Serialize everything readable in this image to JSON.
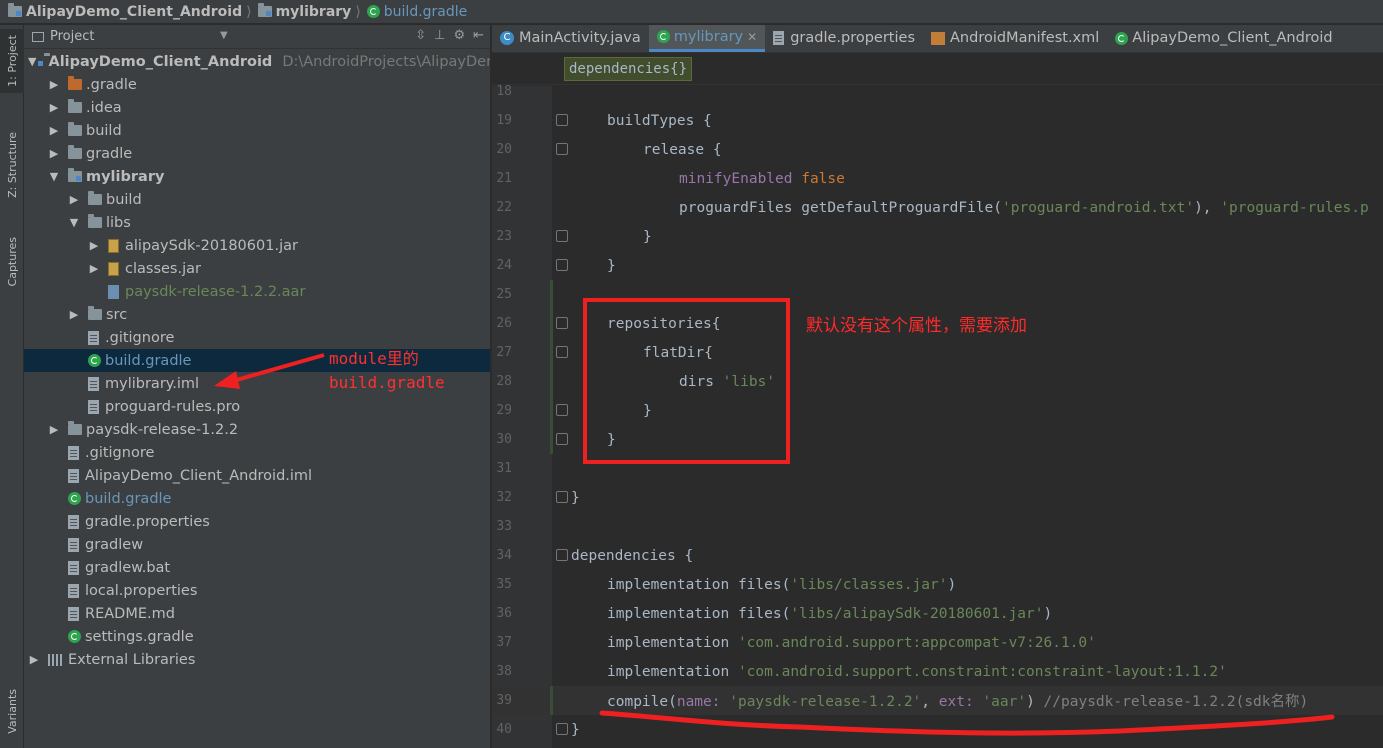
{
  "navbar": {
    "crumbs": [
      "AlipayDemo_Client_Android",
      "mylibrary",
      "build.gradle"
    ]
  },
  "tool_strip": {
    "tabs": [
      "1: Project",
      "Z: Structure",
      "Captures",
      "Variants"
    ]
  },
  "project_panel": {
    "header": "Project",
    "tree": [
      {
        "label": "AlipayDemo_Client_Android",
        "path": "D:\\AndroidProjects\\AlipayDemo_",
        "icon": "module-folder-icon",
        "arrow": "down",
        "depth": 0,
        "bold": true
      },
      {
        "label": ".gradle",
        "icon": "folder-orange-icon",
        "arrow": "right",
        "depth": 1
      },
      {
        "label": ".idea",
        "icon": "folder-icon",
        "arrow": "right",
        "depth": 1
      },
      {
        "label": "build",
        "icon": "folder-icon",
        "arrow": "right",
        "depth": 1
      },
      {
        "label": "gradle",
        "icon": "folder-icon",
        "arrow": "right",
        "depth": 1
      },
      {
        "label": "mylibrary",
        "icon": "module-folder-icon",
        "arrow": "down",
        "depth": 1,
        "bold": true
      },
      {
        "label": "build",
        "icon": "folder-icon",
        "arrow": "right",
        "depth": 2
      },
      {
        "label": "libs",
        "icon": "folder-icon",
        "arrow": "down",
        "depth": 2
      },
      {
        "label": "alipaySdk-20180601.jar",
        "icon": "jar-icon",
        "arrow": "right",
        "depth": 3
      },
      {
        "label": "classes.jar",
        "icon": "jar-icon",
        "arrow": "right",
        "depth": 3
      },
      {
        "label": "paysdk-release-1.2.2.aar",
        "icon": "aar-icon",
        "arrow": "none",
        "depth": 3,
        "color": "green"
      },
      {
        "label": "src",
        "icon": "folder-icon",
        "arrow": "right",
        "depth": 2
      },
      {
        "label": ".gitignore",
        "icon": "file-icon",
        "arrow": "none",
        "depth": 2
      },
      {
        "label": "build.gradle",
        "icon": "gradle-icon",
        "arrow": "none",
        "depth": 2,
        "selected": true,
        "color": "blue"
      },
      {
        "label": "mylibrary.iml",
        "icon": "iml-icon",
        "arrow": "none",
        "depth": 2
      },
      {
        "label": "proguard-rules.pro",
        "icon": "file-icon",
        "arrow": "none",
        "depth": 2
      },
      {
        "label": "paysdk-release-1.2.2",
        "icon": "folder-icon",
        "arrow": "right",
        "depth": 1
      },
      {
        "label": ".gitignore",
        "icon": "file-icon",
        "arrow": "none",
        "depth": 1
      },
      {
        "label": "AlipayDemo_Client_Android.iml",
        "icon": "iml-icon",
        "arrow": "none",
        "depth": 1
      },
      {
        "label": "build.gradle",
        "icon": "gradle-icon",
        "arrow": "none",
        "depth": 1,
        "color": "blue"
      },
      {
        "label": "gradle.properties",
        "icon": "properties-icon",
        "arrow": "none",
        "depth": 1
      },
      {
        "label": "gradlew",
        "icon": "file-icon",
        "arrow": "none",
        "depth": 1
      },
      {
        "label": "gradlew.bat",
        "icon": "file-icon",
        "arrow": "none",
        "depth": 1
      },
      {
        "label": "local.properties",
        "icon": "properties-icon",
        "arrow": "none",
        "depth": 1
      },
      {
        "label": "README.md",
        "icon": "file-icon",
        "arrow": "none",
        "depth": 1
      },
      {
        "label": "settings.gradle",
        "icon": "gradle-icon",
        "arrow": "none",
        "depth": 1
      },
      {
        "label": "External Libraries",
        "icon": "library-icon",
        "arrow": "right",
        "depth": 0
      }
    ]
  },
  "editor": {
    "tabs": [
      {
        "label": "MainActivity.java",
        "icon": "java-class-icon"
      },
      {
        "label": "mylibrary",
        "icon": "gradle-icon",
        "active": true,
        "closable": true
      },
      {
        "label": "gradle.properties",
        "icon": "properties-icon"
      },
      {
        "label": "AndroidManifest.xml",
        "icon": "xml-icon"
      },
      {
        "label": "AlipayDemo_Client_Android",
        "icon": "gradle-icon"
      }
    ],
    "breadcrumb_chip": "dependencies{}",
    "lines": [
      {
        "n": "18",
        "indent": 0,
        "tokens": []
      },
      {
        "n": "19",
        "indent": 1,
        "fold": true,
        "tokens": [
          [
            "plain",
            "buildTypes {"
          ]
        ]
      },
      {
        "n": "20",
        "indent": 2,
        "fold": true,
        "tokens": [
          [
            "plain",
            "release {"
          ]
        ]
      },
      {
        "n": "21",
        "indent": 3,
        "tokens": [
          [
            "prop",
            "minifyEnabled "
          ],
          [
            "kw",
            "false"
          ]
        ]
      },
      {
        "n": "22",
        "indent": 3,
        "tokens": [
          [
            "plain",
            "proguardFiles getDefaultProguardFile("
          ],
          [
            "str",
            "'proguard-android.txt'"
          ],
          [
            "plain",
            "), "
          ],
          [
            "str",
            "'proguard-rules.p"
          ]
        ]
      },
      {
        "n": "23",
        "indent": 2,
        "fold": true,
        "tokens": [
          [
            "plain",
            "}"
          ]
        ]
      },
      {
        "n": "24",
        "indent": 1,
        "fold": true,
        "tokens": [
          [
            "plain",
            "}"
          ]
        ]
      },
      {
        "n": "25",
        "indent": 0,
        "tokens": [],
        "changed": true
      },
      {
        "n": "26",
        "indent": 1,
        "fold": true,
        "tokens": [
          [
            "plain",
            "repositories{"
          ]
        ],
        "changed": true
      },
      {
        "n": "27",
        "indent": 2,
        "fold": true,
        "tokens": [
          [
            "plain",
            "flatDir{"
          ]
        ],
        "changed": true
      },
      {
        "n": "28",
        "indent": 3,
        "tokens": [
          [
            "plain",
            "dirs "
          ],
          [
            "str",
            "'libs'"
          ]
        ],
        "changed": true
      },
      {
        "n": "29",
        "indent": 2,
        "fold": true,
        "tokens": [
          [
            "plain",
            "}"
          ]
        ],
        "changed": true
      },
      {
        "n": "30",
        "indent": 1,
        "fold": true,
        "tokens": [
          [
            "plain",
            "}"
          ]
        ],
        "changed": true
      },
      {
        "n": "31",
        "indent": 0,
        "tokens": []
      },
      {
        "n": "32",
        "indent": 0,
        "fold": true,
        "tokens": [
          [
            "plain",
            "}"
          ]
        ]
      },
      {
        "n": "33",
        "indent": 0,
        "tokens": []
      },
      {
        "n": "34",
        "indent": 0,
        "fold": true,
        "tokens": [
          [
            "plain",
            "dependencies {"
          ]
        ]
      },
      {
        "n": "35",
        "indent": 1,
        "tokens": [
          [
            "plain",
            "implementation files("
          ],
          [
            "str",
            "'libs/classes.jar'"
          ],
          [
            "plain",
            ")"
          ]
        ]
      },
      {
        "n": "36",
        "indent": 1,
        "tokens": [
          [
            "plain",
            "implementation files("
          ],
          [
            "str",
            "'libs/alipaySdk-20180601.jar'"
          ],
          [
            "plain",
            ")"
          ]
        ]
      },
      {
        "n": "37",
        "indent": 1,
        "tokens": [
          [
            "plain",
            "implementation "
          ],
          [
            "str",
            "'com.android.support:appcompat-v7:26.1.0'"
          ]
        ]
      },
      {
        "n": "38",
        "indent": 1,
        "tokens": [
          [
            "plain",
            "implementation "
          ],
          [
            "str",
            "'com.android.support.constraint:constraint-layout:1.1.2'"
          ]
        ]
      },
      {
        "n": "39",
        "indent": 1,
        "cursor": true,
        "changed": true,
        "tokens": [
          [
            "plain",
            "compile("
          ],
          [
            "prop",
            "name: "
          ],
          [
            "str",
            "'paysdk-release-1.2.2'"
          ],
          [
            "plain",
            ", "
          ],
          [
            "prop",
            "ext: "
          ],
          [
            "str",
            "'aar'"
          ],
          [
            "plain",
            ") "
          ],
          [
            "cmt",
            "//paysdk-release-1.2.2(sdk名称)"
          ]
        ]
      },
      {
        "n": "40",
        "indent": 0,
        "fold": true,
        "tokens": [
          [
            "plain",
            "}"
          ]
        ]
      }
    ]
  },
  "annotations": {
    "box_note": "默认没有这个属性，需要添加",
    "module_note_line1": "module里的",
    "module_note_line2": "build.gradle",
    "color": "#ee2020"
  }
}
